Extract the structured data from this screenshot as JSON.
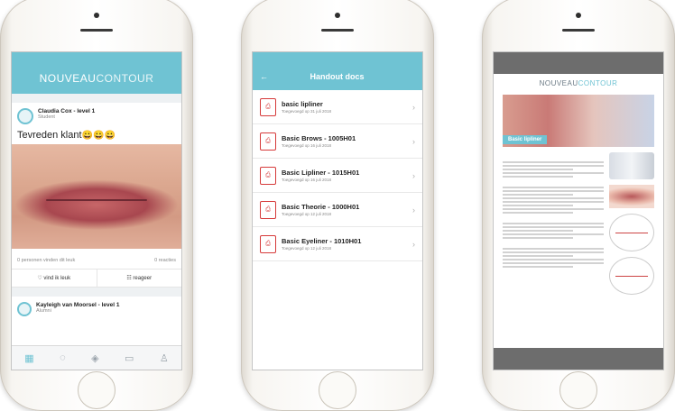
{
  "phone1": {
    "brand_main": "NOUVEAU",
    "brand_accent": "CONTOUR",
    "post": {
      "author": "Claudia Cox - level 1",
      "role": "Student",
      "text": "Tevreden klant",
      "emojis": "😀😀😀",
      "likes": "0 personen vinden dit leuk",
      "reactions": "0 reacties"
    },
    "actions": {
      "like": "♡ vind ik leuk",
      "reply": "☷ reageer"
    },
    "post2": {
      "author": "Kayleigh van Moorsel - level 1",
      "role": "Alumni"
    },
    "tabs": [
      "home-icon",
      "chat-icon",
      "layers-icon",
      "archive-icon",
      "profile-icon"
    ]
  },
  "phone2": {
    "title": "Handout docs",
    "docs": [
      {
        "name": "basic lipliner",
        "date": "Toegevoegd op 31 juli 2018"
      },
      {
        "name": "Basic Brows - 1005H01",
        "date": "Toegevoegd op 16 juli 2018"
      },
      {
        "name": "Basic Lipliner - 1015H01",
        "date": "Toegevoegd op 16 juli 2018"
      },
      {
        "name": "Basic Theorie - 1000H01",
        "date": "Toegevoegd op 12 juli 2018"
      },
      {
        "name": "Basic Eyeliner - 1010H01",
        "date": "Toegevoegd op 12 juli 2018"
      }
    ]
  },
  "phone3": {
    "brand_main": "NOUVEAU",
    "brand_accent": "CONTOUR",
    "banner": "Basic lipliner"
  },
  "colors": {
    "accent": "#6fc3d3",
    "pdf_red": "#d63a3a"
  }
}
